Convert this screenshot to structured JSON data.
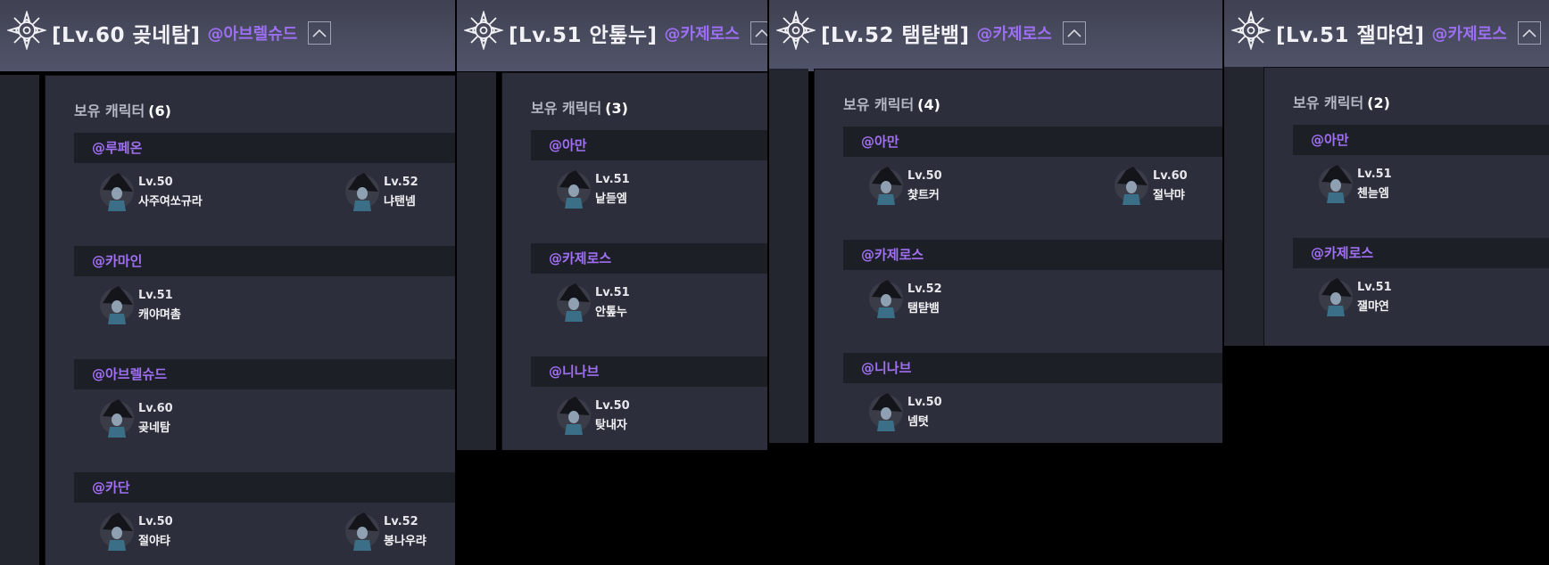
{
  "colors": {
    "accent_purple": "#9d6ff2",
    "header_bg": "#4a4d60",
    "content_bg": "#2c2f3b",
    "group_header_bg": "#1d1f27"
  },
  "panels": [
    {
      "title": "[Lv.60 곶네탐]",
      "server": "@아브렐슈드",
      "collapse_icon": "chevron-up-icon",
      "section_label": "보유 캐릭터",
      "count": "(6)",
      "groups": [
        {
          "name": "@루페온",
          "characters": [
            {
              "level": "Lv.50",
              "name": "사주여쏘규라"
            },
            {
              "level": "Lv.52",
              "name": "냐탠넴"
            }
          ]
        },
        {
          "name": "@카마인",
          "characters": [
            {
              "level": "Lv.51",
              "name": "캐야며촘"
            }
          ]
        },
        {
          "name": "@아브렐슈드",
          "characters": [
            {
              "level": "Lv.60",
              "name": "곶네탐"
            }
          ]
        },
        {
          "name": "@카단",
          "characters": [
            {
              "level": "Lv.50",
              "name": "절야탸"
            },
            {
              "level": "Lv.52",
              "name": "봉나우랴"
            }
          ]
        }
      ]
    },
    {
      "title": "[Lv.51 안톺누]",
      "server": "@카제로스",
      "collapse_icon": "chevron-up-icon",
      "section_label": "보유 캐릭터",
      "count": "(3)",
      "groups": [
        {
          "name": "@아만",
          "characters": [
            {
              "level": "Lv.51",
              "name": "낱듣엠"
            }
          ]
        },
        {
          "name": "@카제로스",
          "characters": [
            {
              "level": "Lv.51",
              "name": "안톺누"
            }
          ]
        },
        {
          "name": "@니나브",
          "characters": [
            {
              "level": "Lv.50",
              "name": "탖내자"
            }
          ]
        }
      ]
    },
    {
      "title": "[Lv.52 탬탿뱀]",
      "server": "@카제로스",
      "collapse_icon": "chevron-up-icon",
      "section_label": "보유 캐릭터",
      "count": "(4)",
      "groups": [
        {
          "name": "@아만",
          "characters": [
            {
              "level": "Lv.50",
              "name": "챷트커"
            },
            {
              "level": "Lv.60",
              "name": "절냑먀"
            }
          ]
        },
        {
          "name": "@카제로스",
          "characters": [
            {
              "level": "Lv.52",
              "name": "탬탿뱀"
            }
          ]
        },
        {
          "name": "@니나브",
          "characters": [
            {
              "level": "Lv.50",
              "name": "넴텻"
            }
          ]
        }
      ]
    },
    {
      "title": "[Lv.51 잴먀연]",
      "server": "@카제로스",
      "collapse_icon": "chevron-up-icon",
      "section_label": "보유 캐릭터",
      "count": "(2)",
      "groups": [
        {
          "name": "@아만",
          "characters": [
            {
              "level": "Lv.51",
              "name": "첸늗엠"
            }
          ]
        },
        {
          "name": "@카제로스",
          "characters": [
            {
              "level": "Lv.51",
              "name": "잴먀연"
            }
          ]
        }
      ]
    }
  ]
}
